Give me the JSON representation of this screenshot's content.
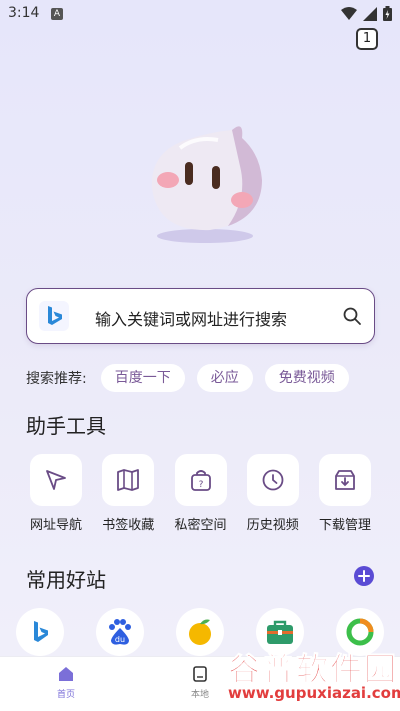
{
  "status_bar": {
    "time": "3:14",
    "notify_letter": "A"
  },
  "tab_count": "1",
  "search": {
    "placeholder": "输入关键词或网址进行搜索"
  },
  "hot": {
    "label": "搜索推荐:",
    "chips": [
      "百度一下",
      "必应",
      "免费视频"
    ]
  },
  "tools": {
    "title": "助手工具",
    "items": [
      {
        "label": "网址导航",
        "icon": "cursor-icon"
      },
      {
        "label": "书签收藏",
        "icon": "map-book-icon"
      },
      {
        "label": "私密空间",
        "icon": "private-bag-icon"
      },
      {
        "label": "历史视频",
        "icon": "clock-icon"
      },
      {
        "label": "下载管理",
        "icon": "download-box-icon"
      }
    ]
  },
  "sites": {
    "title": "常用好站",
    "items": [
      {
        "icon": "bing-logo"
      },
      {
        "icon": "baidu-logo"
      },
      {
        "icon": "fruit-logo"
      },
      {
        "icon": "briefcase-logo"
      },
      {
        "icon": "ring-logo"
      }
    ]
  },
  "bottom_nav": [
    {
      "label": "首页",
      "icon": "home-icon"
    },
    {
      "label": "本地",
      "icon": "local-file-icon"
    }
  ],
  "watermark": {
    "title": "谷普软件园",
    "url": "www.gupuxiazai.com"
  },
  "colors": {
    "accent": "#6a4c86",
    "primary": "#5a4bd4",
    "chip_text": "#7a5a98"
  }
}
